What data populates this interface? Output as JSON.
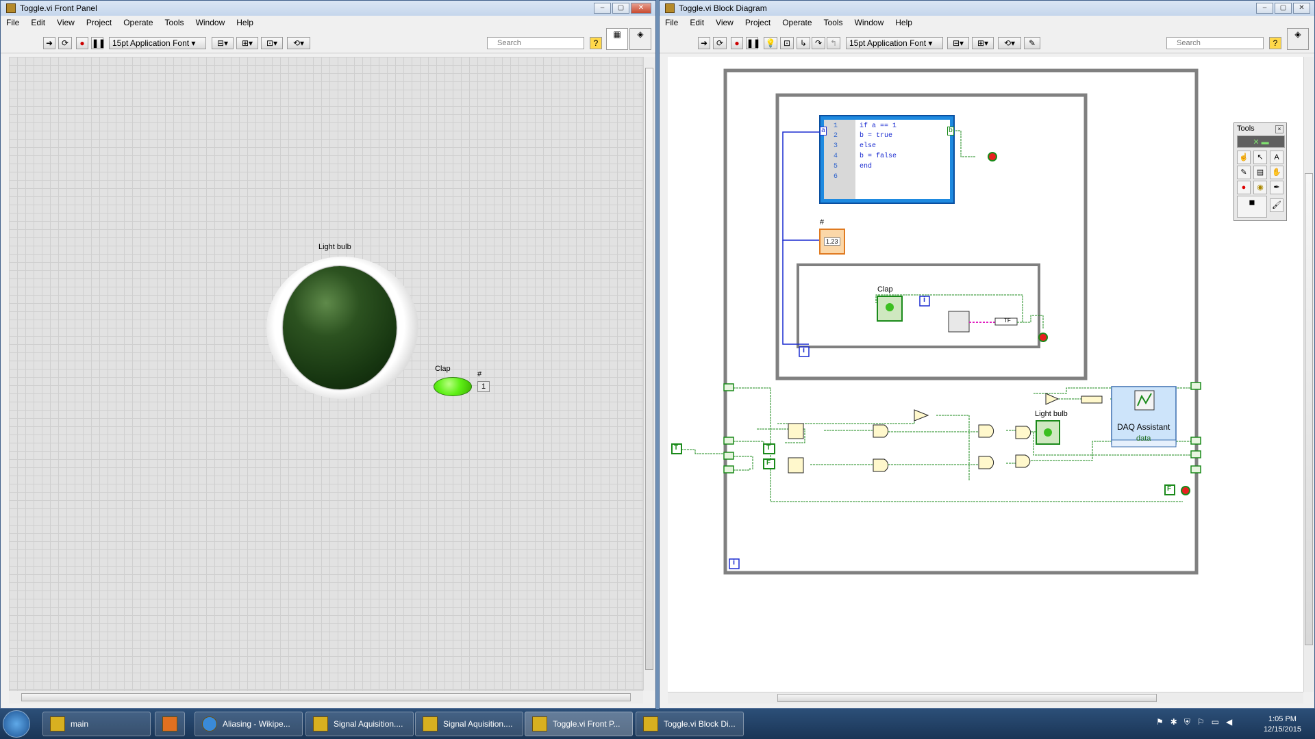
{
  "front_panel": {
    "title": "Toggle.vi Front Panel",
    "menu": [
      "File",
      "Edit",
      "View",
      "Project",
      "Operate",
      "Tools",
      "Window",
      "Help"
    ],
    "font_select": "15pt Application Font",
    "search_placeholder": "Search",
    "light_bulb_label": "Light bulb",
    "clap_label": "Clap",
    "counter_label": "#",
    "counter_value": "1"
  },
  "block_diagram": {
    "title": "Toggle.vi Block Diagram",
    "menu": [
      "File",
      "Edit",
      "View",
      "Project",
      "Operate",
      "Tools",
      "Window",
      "Help"
    ],
    "font_select": "15pt Application Font",
    "search_placeholder": "Search",
    "script_lines": [
      {
        "num": "1",
        "text": "if a == 1"
      },
      {
        "num": "2",
        "text": "b = true"
      },
      {
        "num": "3",
        "text": "else"
      },
      {
        "num": "4",
        "text": "b = false"
      },
      {
        "num": "5",
        "text": "end"
      },
      {
        "num": "6",
        "text": ""
      }
    ],
    "script_input": "a",
    "script_output": "b",
    "counter_label": "#",
    "counter_indicator": "1.23",
    "clap_label": "Clap",
    "light_bulb_label": "Light bulb",
    "daq_title": "DAQ Assistant",
    "daq_output": "data",
    "iter_label": "i",
    "true_const": "T",
    "false_const": "F",
    "tf_label": "TF"
  },
  "tools_palette": {
    "title": "Tools"
  },
  "window_buttons": {
    "min": "–",
    "max": "▢",
    "close": "✕"
  },
  "taskbar": {
    "items": [
      {
        "label": "main"
      },
      {
        "label": ""
      },
      {
        "label": "Aliasing - Wikipe..."
      },
      {
        "label": "Signal Aquisition...."
      },
      {
        "label": "Signal Aquisition...."
      },
      {
        "label": "Toggle.vi Front P..."
      },
      {
        "label": "Toggle.vi Block Di..."
      }
    ],
    "time": "1:05 PM",
    "date": "12/15/2015"
  },
  "colors": {
    "bulb_off": "#1d3d14",
    "clap_led": "#5ef016",
    "wire_bool": "#1a8a1a",
    "wire_num": "#1a2bd0",
    "wire_dyn": "#e020c0",
    "struct_grey": "#7a7a7a"
  }
}
